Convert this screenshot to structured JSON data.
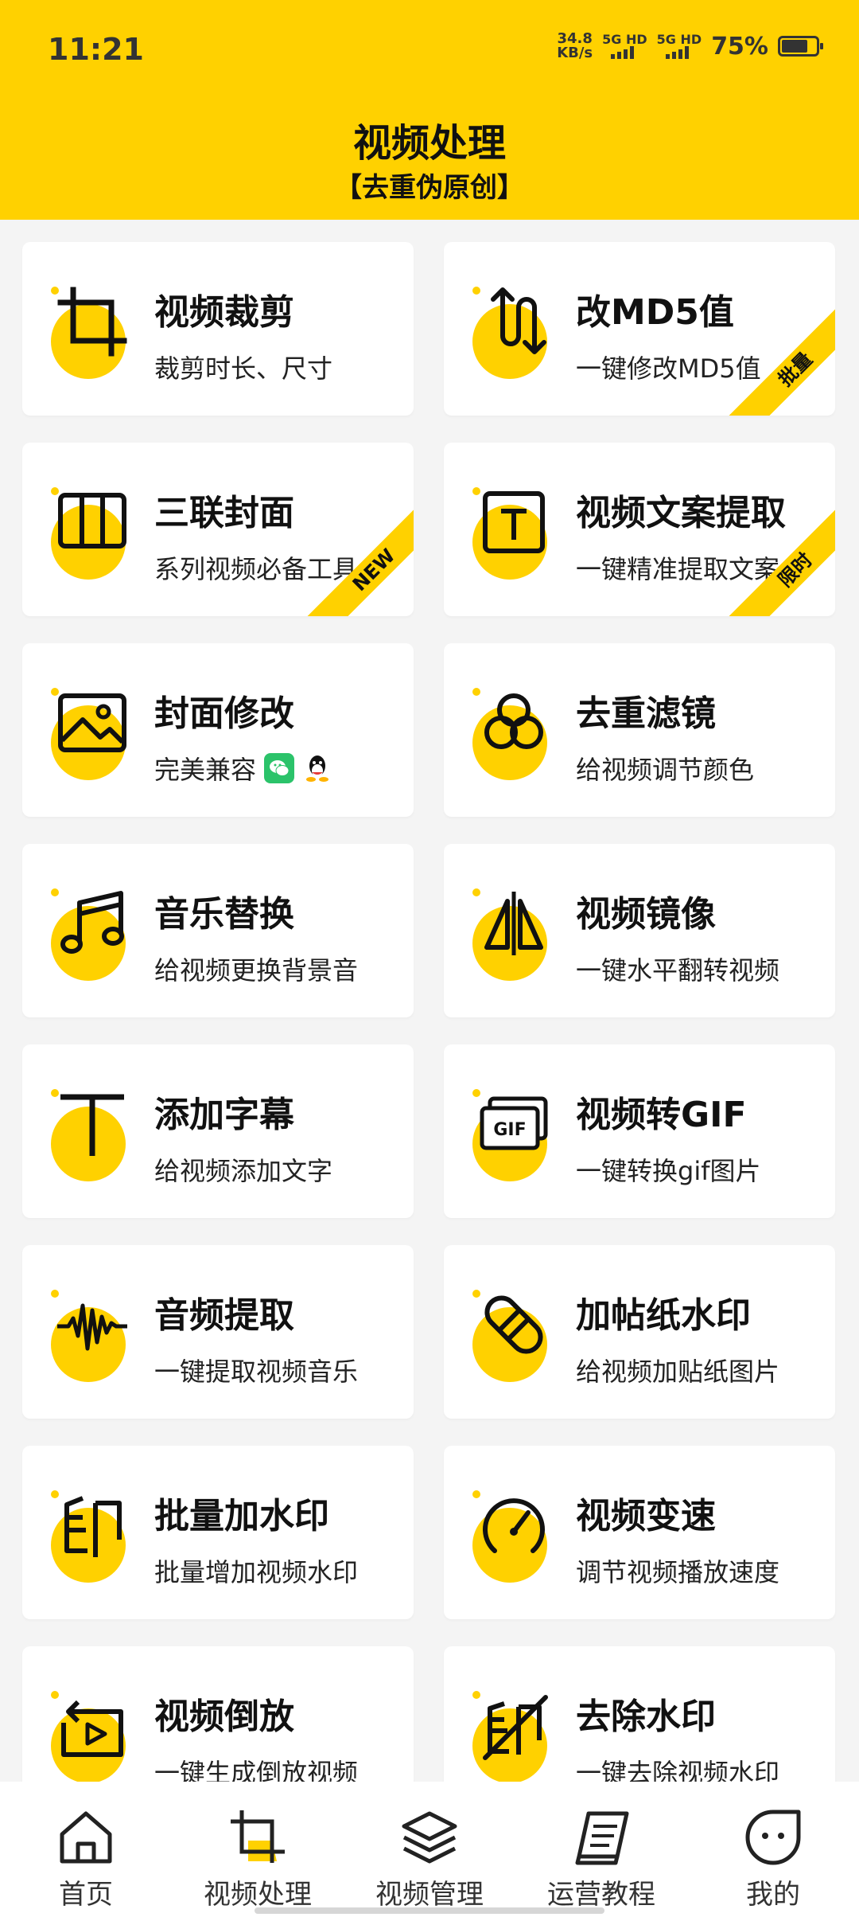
{
  "status": {
    "time": "11:21",
    "net_speed": "34.8",
    "net_unit": "KB/s",
    "sim1": "5G HD",
    "sim2": "5G HD",
    "battery": "75%"
  },
  "header": {
    "title": "视频处理",
    "subtitle": "【去重伪原创】"
  },
  "colors": {
    "accent": "#FFD100",
    "wechat": "#2BC36A"
  },
  "cards": [
    {
      "icon": "crop-icon",
      "title": "视频裁剪",
      "subtitle": "裁剪时长、尺寸"
    },
    {
      "icon": "md5-arrows-icon",
      "title": "改MD5值",
      "subtitle": "一键修改MD5值",
      "ribbon": "批量"
    },
    {
      "icon": "triptych-icon",
      "title": "三联封面",
      "subtitle": "系列视频必备工具",
      "ribbon": "NEW"
    },
    {
      "icon": "text-box-icon",
      "title": "视频文案提取",
      "subtitle": "一键精准提取文案",
      "ribbon": "限时"
    },
    {
      "icon": "image-icon",
      "title": "封面修改",
      "subtitle": "完美兼容"
    },
    {
      "icon": "filter-circles-icon",
      "title": "去重滤镜",
      "subtitle": "给视频调节颜色"
    },
    {
      "icon": "music-note-icon",
      "title": "音乐替换",
      "subtitle": "给视频更换背景音"
    },
    {
      "icon": "mirror-icon",
      "title": "视频镜像",
      "subtitle": "一键水平翻转视频"
    },
    {
      "icon": "text-t-icon",
      "title": "添加字幕",
      "subtitle": "给视频添加文字"
    },
    {
      "icon": "gif-icon",
      "title": "视频转GIF",
      "subtitle": "一键转换gif图片"
    },
    {
      "icon": "waveform-icon",
      "title": "音频提取",
      "subtitle": "一键提取视频音乐"
    },
    {
      "icon": "sticker-icon",
      "title": "加帖纸水印",
      "subtitle": "给视频加贴纸图片"
    },
    {
      "icon": "stamp-icon",
      "title": "批量加水印",
      "subtitle": "批量增加视频水印"
    },
    {
      "icon": "speedometer-icon",
      "title": "视频变速",
      "subtitle": "调节视频播放速度"
    },
    {
      "icon": "reverse-play-icon",
      "title": "视频倒放",
      "subtitle": "一键生成倒放视频"
    },
    {
      "icon": "remove-stamp-icon",
      "title": "去除水印",
      "subtitle": "一键去除视频水印"
    }
  ],
  "tabs": [
    {
      "icon": "home-icon",
      "label": "首页"
    },
    {
      "icon": "video-process-icon",
      "label": "视频处理"
    },
    {
      "icon": "layers-icon",
      "label": "视频管理"
    },
    {
      "icon": "book-icon",
      "label": "运营教程"
    },
    {
      "icon": "face-icon",
      "label": "我的"
    }
  ]
}
